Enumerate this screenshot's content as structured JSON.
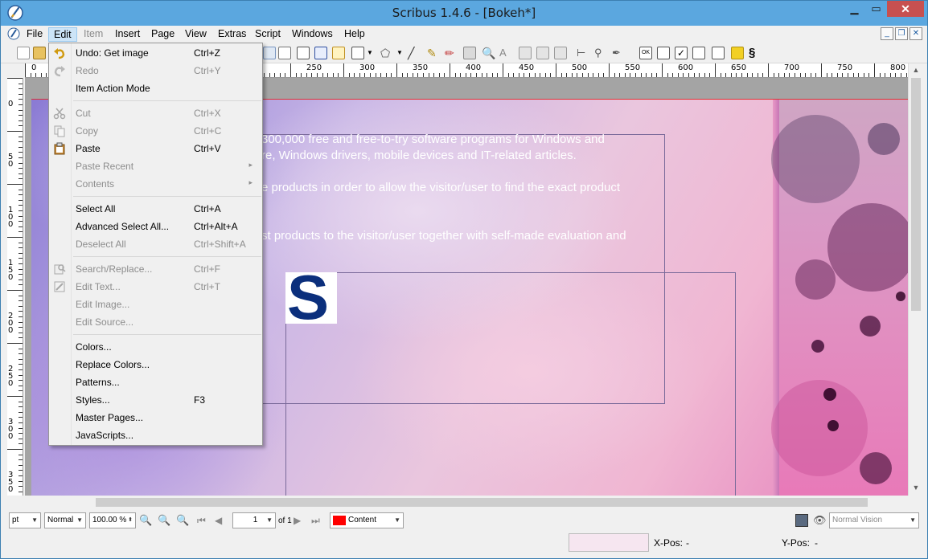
{
  "window": {
    "title": "Scribus 1.4.6 - [Bokeh*]"
  },
  "menubar": {
    "items": [
      {
        "label": "File"
      },
      {
        "label": "Edit"
      },
      {
        "label": "Item"
      },
      {
        "label": "Insert"
      },
      {
        "label": "Page"
      },
      {
        "label": "View"
      },
      {
        "label": "Extras"
      },
      {
        "label": "Script"
      },
      {
        "label": "Windows"
      },
      {
        "label": "Help"
      }
    ]
  },
  "ruler": {
    "h_labels": [
      "0",
      "250",
      "300",
      "350",
      "400",
      "450",
      "500",
      "550",
      "600",
      "650",
      "700",
      "750",
      "800"
    ],
    "v_labels": [
      "0",
      "50",
      "100",
      "150",
      "200",
      "250",
      "300",
      "350"
    ]
  },
  "edit_menu": {
    "items": [
      {
        "label": "Undo: Get image",
        "shortcut": "Ctrl+Z"
      },
      {
        "label": "Redo",
        "shortcut": "Ctrl+Y"
      },
      {
        "label": "Item Action Mode",
        "shortcut": ""
      },
      {
        "label": "Cut",
        "shortcut": "Ctrl+X"
      },
      {
        "label": "Copy",
        "shortcut": "Ctrl+C"
      },
      {
        "label": "Paste",
        "shortcut": "Ctrl+V"
      },
      {
        "label": "Paste Recent",
        "shortcut": ""
      },
      {
        "label": "Contents",
        "shortcut": ""
      },
      {
        "label": "Select All",
        "shortcut": "Ctrl+A"
      },
      {
        "label": "Advanced Select All...",
        "shortcut": "Ctrl+Alt+A"
      },
      {
        "label": "Deselect All",
        "shortcut": "Ctrl+Shift+A"
      },
      {
        "label": "Search/Replace...",
        "shortcut": "Ctrl+F"
      },
      {
        "label": "Edit Text...",
        "shortcut": "Ctrl+T"
      },
      {
        "label": "Edit Image...",
        "shortcut": ""
      },
      {
        "label": "Edit Source...",
        "shortcut": ""
      },
      {
        "label": "Colors...",
        "shortcut": ""
      },
      {
        "label": "Replace Colors...",
        "shortcut": ""
      },
      {
        "label": "Patterns...",
        "shortcut": ""
      },
      {
        "label": "Styles...",
        "shortcut": "F3"
      },
      {
        "label": "Master Pages...",
        "shortcut": ""
      },
      {
        "label": "JavaScripts...",
        "shortcut": ""
      }
    ],
    "submenu_arrow": "▸"
  },
  "page_text": {
    "line1": "300,000 free and free-to-try software programs for Windows and",
    "line2": "re, Windows drivers, mobile devices and IT-related articles.",
    "line3": "e products in order to allow the visitor/user to find the exact product",
    "line4": "st products to the visitor/user together with self-made evaluation and",
    "logo_letter": "S"
  },
  "bottombar": {
    "unit": "pt",
    "mode": "Normal",
    "zoom": "100.00 %",
    "page_number": "1",
    "page_of": "of 1",
    "layer": "Content",
    "vision": "Normal Vision"
  },
  "statusbar": {
    "xpos_label": "X-Pos:",
    "xpos_value": "-",
    "ypos_label": "Y-Pos:",
    "ypos_value": "-"
  },
  "colors": {
    "titlebar": "#5ba7df",
    "close_button": "#c75050",
    "layer_swatch": "#ff0000",
    "logo_blue": "#0b2f7c"
  }
}
